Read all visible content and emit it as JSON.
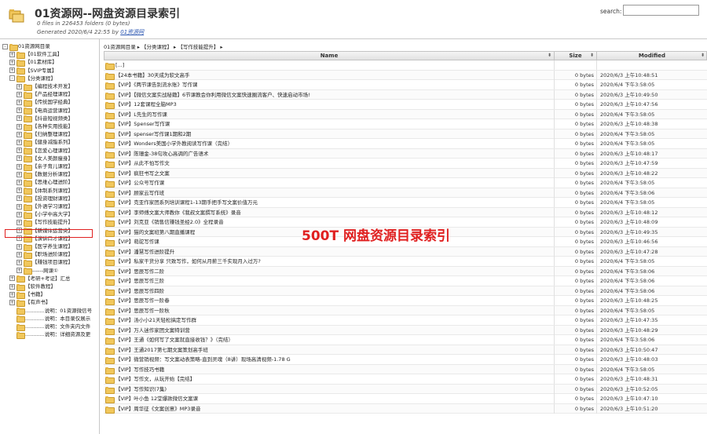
{
  "header": {
    "title": "01资源网--网盘资源目录索引",
    "meta_line1": "0 files in 226453 folders (0 bytes)",
    "meta_generated": "Generated 2020/6/4 22:55 by ",
    "meta_author": "01资源网",
    "search_label": "search:",
    "search_value": ""
  },
  "tree": {
    "nodes": [
      {
        "label": "01资源网目录",
        "indent": 0,
        "toggle": "-"
      },
      {
        "label": "【01软件工具】",
        "indent": 1,
        "toggle": "+"
      },
      {
        "label": "【01素材库】",
        "indent": 1,
        "toggle": "+"
      },
      {
        "label": "【SVIP专属】",
        "indent": 1,
        "toggle": "+"
      },
      {
        "label": "【分类课程】",
        "indent": 1,
        "toggle": "-"
      },
      {
        "label": "【编程技术开发】",
        "indent": 2,
        "toggle": "+"
      },
      {
        "label": "【产品经理课程】",
        "indent": 2,
        "toggle": "+"
      },
      {
        "label": "【传统国学经典】",
        "indent": 2,
        "toggle": "+"
      },
      {
        "label": "【电商运营课程】",
        "indent": 2,
        "toggle": "+"
      },
      {
        "label": "【抖音短视频类】",
        "indent": 2,
        "toggle": "+"
      },
      {
        "label": "【各种实用技能】",
        "indent": 2,
        "toggle": "+"
      },
      {
        "label": "【归纳整理课程】",
        "indent": 2,
        "toggle": "+"
      },
      {
        "label": "【健身减脂系列】",
        "indent": 2,
        "toggle": "+"
      },
      {
        "label": "【恋爱心理课程】",
        "indent": 2,
        "toggle": "+"
      },
      {
        "label": "【女人美颜瘦身】",
        "indent": 2,
        "toggle": "+"
      },
      {
        "label": "【亲子育儿课程】",
        "indent": 2,
        "toggle": "+"
      },
      {
        "label": "【数据分析课程】",
        "indent": 2,
        "toggle": "+"
      },
      {
        "label": "【思维心理进阶】",
        "indent": 2,
        "toggle": "+"
      },
      {
        "label": "【体制系列课程】",
        "indent": 2,
        "toggle": "+"
      },
      {
        "label": "【投资理财课程】",
        "indent": 2,
        "toggle": "+"
      },
      {
        "label": "【外语学习课程】",
        "indent": 2,
        "toggle": "+"
      },
      {
        "label": "【小学中高大学】",
        "indent": 2,
        "toggle": "+"
      },
      {
        "label": "【写作技能提升】",
        "indent": 2,
        "toggle": "+"
      },
      {
        "label": "【新媒体运营类】",
        "indent": 2,
        "toggle": "+"
      },
      {
        "label": "【演讲口才课程】",
        "indent": 2,
        "toggle": "+"
      },
      {
        "label": "【医学养生课程】",
        "indent": 2,
        "toggle": "+"
      },
      {
        "label": "【职场进阶课程】",
        "indent": 2,
        "toggle": "+"
      },
      {
        "label": "【赚钱项目课程】",
        "indent": 2,
        "toggle": "+"
      },
      {
        "label": "------网课①",
        "indent": 2,
        "toggle": "+"
      },
      {
        "label": "【考研+考证】汇总",
        "indent": 1,
        "toggle": "+"
      },
      {
        "label": "【软件教程】",
        "indent": 1,
        "toggle": "+"
      },
      {
        "label": "【书籍】",
        "indent": 1,
        "toggle": "+"
      },
      {
        "label": "【有声书】",
        "indent": 1,
        "toggle": "+"
      },
      {
        "label": "............说明：01资源微信号",
        "indent": 1,
        "toggle": ""
      },
      {
        "label": "............说明：本目录仅展示",
        "indent": 1,
        "toggle": ""
      },
      {
        "label": "............说明：文件夹内文件",
        "indent": 1,
        "toggle": ""
      },
      {
        "label": "............说明：详细资源及更",
        "indent": 1,
        "toggle": ""
      }
    ]
  },
  "breadcrumb": [
    "01资源网目录",
    "▸",
    "【分类课程】",
    "▸",
    "【写作技能提升】",
    "▸"
  ],
  "columns": {
    "name": "Name",
    "size": "Size",
    "modified": "Modified",
    "sort_glyph": "⬍"
  },
  "rows": [
    {
      "name": "[...]",
      "size": "",
      "modified": ""
    },
    {
      "name": "【24本书籍】30天成为软文高手",
      "size": "0 bytes",
      "modified": "2020/6/3 上午10:48:51"
    },
    {
      "name": "【VIP】《两节课告别流水账》写作课",
      "size": "0 bytes",
      "modified": "2020/6/4 下午3:58:05"
    },
    {
      "name": "【VIP】【微信文案实战秘籍】6节课教会你利用微信文案快速圈流客户、快速启动市场!",
      "size": "0 bytes",
      "modified": "2020/6/3 上午10:49:50"
    },
    {
      "name": "【VIP】12套课程全脑MP3",
      "size": "0 bytes",
      "modified": "2020/6/3 上午10:47:56"
    },
    {
      "name": "【VIP】L先生的写作课",
      "size": "0 bytes",
      "modified": "2020/6/4 下午3:58:05"
    },
    {
      "name": "【VIP】Spenser写作课",
      "size": "0 bytes",
      "modified": "2020/6/3 上午10:48:38"
    },
    {
      "name": "【VIP】spenser写作课1期和2期",
      "size": "0 bytes",
      "modified": "2020/6/4 下午3:58:05"
    },
    {
      "name": "【VIP】Wonders美国小学外教阅读写作课（完结）",
      "size": "0 bytes",
      "modified": "2020/6/4 下午3:58:05"
    },
    {
      "name": "【VIP】陈珊金-38句攻心高调的广告语术",
      "size": "0 bytes",
      "modified": "2020/6/3 上午10:48:17"
    },
    {
      "name": "【VIP】从此不怕写作文",
      "size": "0 bytes",
      "modified": "2020/6/3 上午10:47:59"
    },
    {
      "name": "【VIP】疯狂书写之文案",
      "size": "0 bytes",
      "modified": "2020/6/3 上午10:48:22"
    },
    {
      "name": "【VIP】公众号写作课",
      "size": "0 bytes",
      "modified": "2020/6/4 下午3:58:05"
    },
    {
      "name": "【VIP】顾家云写作班",
      "size": "0 bytes",
      "modified": "2020/6/4 下午3:58:06"
    },
    {
      "name": "【VIP】克亚作家团系列培训课程1-13期手把手写文案价值万元",
      "size": "0 bytes",
      "modified": "2020/6/4 下午3:58:05"
    },
    {
      "name": "【VIP】李师傅文案大师教你《我叔文案撰写系统》录音",
      "size": "0 bytes",
      "modified": "2020/6/3 上午10:48:12"
    },
    {
      "name": "【VIP】刘克亚《销售信赚钱圣经2.0》全程录音",
      "size": "0 bytes",
      "modified": "2020/6/3 上午10:48:09"
    },
    {
      "name": "【VIP】猫的文案班第八期直播课程",
      "size": "0 bytes",
      "modified": "2020/6/3 上午10:49:35"
    },
    {
      "name": "【VIP】萌驼写作课",
      "size": "0 bytes",
      "modified": "2020/6/3 上午10:46:56"
    },
    {
      "name": "【VIP】潘慧写作进阶提升",
      "size": "0 bytes",
      "modified": "2020/6/3 上午10:47:28"
    },
    {
      "name": "【VIP】私家干货分享 只致写作，如何从月薪三千实现月入过万?",
      "size": "0 bytes",
      "modified": "2020/6/4 下午3:58:05"
    },
    {
      "name": "【VIP】思辰写作二阶",
      "size": "0 bytes",
      "modified": "2020/6/4 下午3:58:06"
    },
    {
      "name": "【VIP】思辰写作三阶",
      "size": "0 bytes",
      "modified": "2020/6/4 下午3:58:06"
    },
    {
      "name": "【VIP】思辰写作四阶",
      "size": "0 bytes",
      "modified": "2020/6/4 下午3:58:06"
    },
    {
      "name": "【VIP】思辰写作一阶春",
      "size": "0 bytes",
      "modified": "2020/6/3 上午10:48:25"
    },
    {
      "name": "【VIP】思辰写作一阶秋",
      "size": "0 bytes",
      "modified": "2020/6/4 下午3:58:05"
    },
    {
      "name": "【VIP】汤小小21天轻松搞定写作群",
      "size": "0 bytes",
      "modified": "2020/6/3 上午10:47:35"
    },
    {
      "name": "【VIP】万人迷作家团文案特训营",
      "size": "0 bytes",
      "modified": "2020/6/3 上午10:48:29"
    },
    {
      "name": "【VIP】王通《如何写了文案就直接收钱？》（完结）",
      "size": "0 bytes",
      "modified": "2020/6/4 下午3:58:06"
    },
    {
      "name": "【VIP】王通2017第七期文案策划高手班",
      "size": "0 bytes",
      "modified": "2020/6/3 上午10:50:47"
    },
    {
      "name": "【VIP】微营销视频：写文案动表策略-直到灵魂（8讲）现场高清视频-1.78 G",
      "size": "0 bytes",
      "modified": "2020/6/3 上午10:48:03"
    },
    {
      "name": "【VIP】写作技巧书籍",
      "size": "0 bytes",
      "modified": "2020/6/4 下午3:58:05"
    },
    {
      "name": "【VIP】写作文，从玩开始【完结】",
      "size": "0 bytes",
      "modified": "2020/6/3 上午10:48:31"
    },
    {
      "name": "【VIP】写作知识(7集)",
      "size": "0 bytes",
      "modified": "2020/6/3 上午10:52:05"
    },
    {
      "name": "【VIP】叶小鱼 12堂爆款微信文案课",
      "size": "0 bytes",
      "modified": "2020/6/3 上午10:47:10"
    },
    {
      "name": "【VIP】周华征《文案创意》MP3录音",
      "size": "0 bytes",
      "modified": "2020/6/3 上午10:51:20"
    }
  ],
  "watermark": "500T 网盘资源目录索引"
}
